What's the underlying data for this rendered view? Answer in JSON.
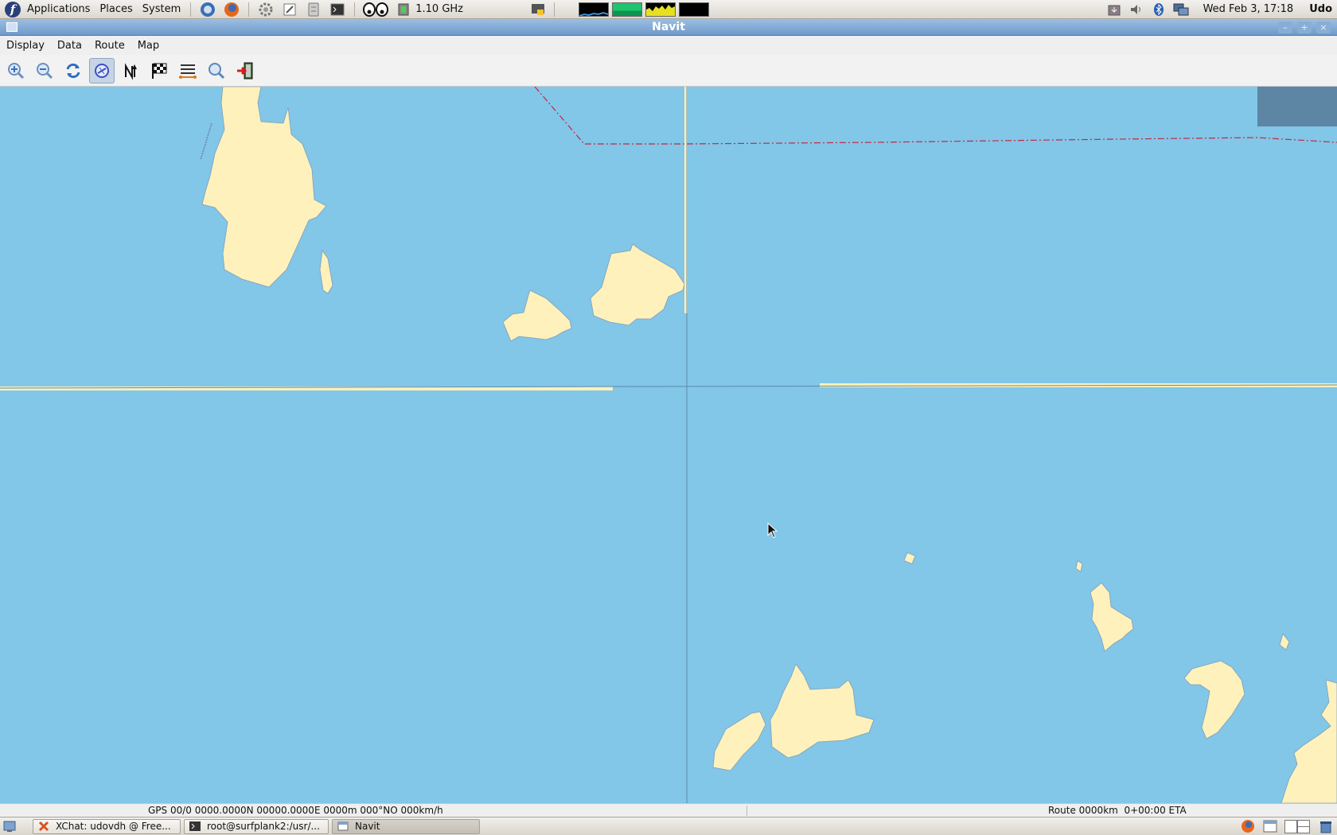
{
  "top_panel": {
    "menus": [
      "Applications",
      "Places",
      "System"
    ],
    "cpu_freq": "1.10 GHz",
    "clock": "Wed Feb  3, 17:18",
    "user": "Udo"
  },
  "window": {
    "title": "Navit"
  },
  "menubar": {
    "items": [
      "Display",
      "Data",
      "Route",
      "Map"
    ]
  },
  "toolbar": {
    "buttons": [
      {
        "icon": "zoom-in-icon"
      },
      {
        "icon": "zoom-out-icon"
      },
      {
        "icon": "refresh-icon"
      },
      {
        "icon": "cursor-follow-icon",
        "active": true
      },
      {
        "icon": "orientation-north-icon"
      },
      {
        "icon": "destination-flag-icon"
      },
      {
        "icon": "roadbook-icon"
      },
      {
        "icon": "search-icon"
      },
      {
        "icon": "quit-icon"
      }
    ]
  },
  "map": {
    "colors": {
      "water": "#82c6e8",
      "land": "#fef1bb",
      "border": "#c02b40",
      "crosshair": "#5d8aa8",
      "equator_band": "#fef1bb",
      "overview_box": "#5d86a4"
    }
  },
  "statusbar": {
    "gps": "GPS 00/0 0000.0000N 00000.0000E 0000m 000°NO 000km/h",
    "route": "Route 0000km  0+00:00 ETA"
  },
  "taskbar": {
    "tasks": [
      {
        "label": "XChat: udovdh @ Free...",
        "active": false
      },
      {
        "label": "root@surfplank2:/usr/...",
        "active": false
      },
      {
        "label": "Navit",
        "active": true
      }
    ]
  }
}
